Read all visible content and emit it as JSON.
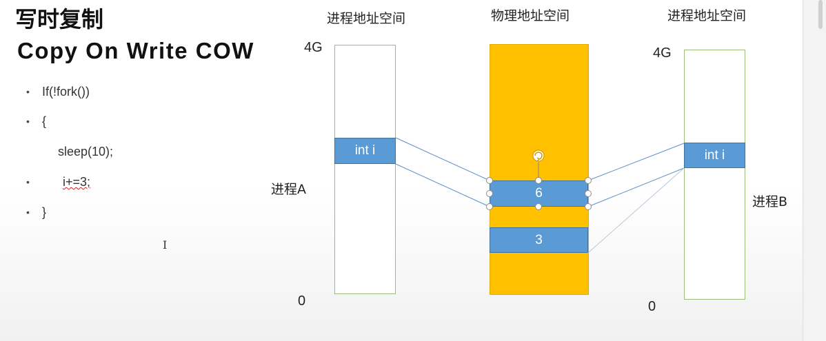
{
  "slide": {
    "title": "写时复制",
    "subtitle": "Copy On Write COW"
  },
  "code": {
    "bullet": "•",
    "lines": [
      "If(!fork())",
      "{",
      "sleep(10);",
      "i+=3;",
      "}"
    ]
  },
  "cursor_glyph": "I",
  "diagram": {
    "process_a": {
      "title": "进程地址空间",
      "label": "进程A",
      "top_label": "4G",
      "bottom_label": "0",
      "cell_label": "int i"
    },
    "physical": {
      "title": "物理地址空间",
      "cell_selected_value": "6",
      "cell_copy_value": "3"
    },
    "process_b": {
      "title": "进程地址空间",
      "label": "进程B",
      "top_label": "4G",
      "bottom_label": "0",
      "cell_label": "int i"
    },
    "colors": {
      "physical_fill": "#ffc000",
      "cell_fill": "#5b9bd5",
      "address_border": "#9bbb7a",
      "mapping_line": "#5b8fc9"
    }
  }
}
